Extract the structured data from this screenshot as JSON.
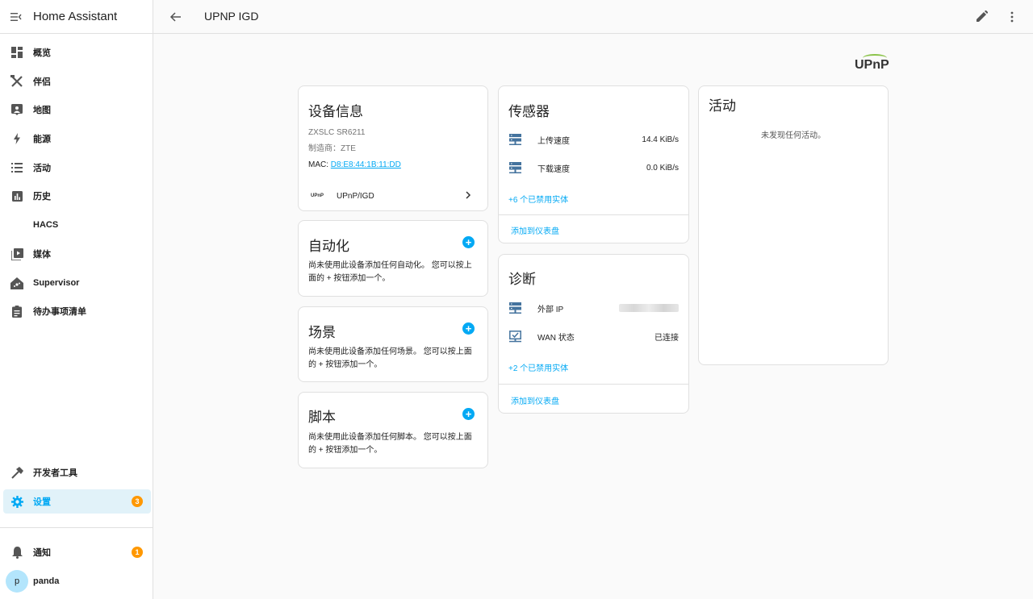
{
  "app": {
    "title": "Home Assistant"
  },
  "sidebar": {
    "items": [
      {
        "label": "概览",
        "icon": "dashboard-icon"
      },
      {
        "label": "伴侣",
        "icon": "tools-icon"
      },
      {
        "label": "地图",
        "icon": "map-icon"
      },
      {
        "label": "能源",
        "icon": "lightning-icon"
      },
      {
        "label": "活动",
        "icon": "list-icon"
      },
      {
        "label": "历史",
        "icon": "chart-icon"
      },
      {
        "label": "HACS",
        "icon": ""
      },
      {
        "label": "媒体",
        "icon": "media-icon"
      },
      {
        "label": "Supervisor",
        "icon": "home-assistant-icon"
      },
      {
        "label": "待办事项清单",
        "icon": "clipboard-icon"
      }
    ],
    "dev_tools": "开发者工具",
    "settings": "设置",
    "settings_badge": "3",
    "notifications": "通知",
    "notifications_badge": "1",
    "user_initial": "p",
    "user_name": "panda"
  },
  "topbar": {
    "title": "UPNP IGD"
  },
  "logo_text": "UPnP",
  "device_info": {
    "title": "设备信息",
    "model": "ZXSLC SR6211",
    "manufacturer": "制造商：ZTE",
    "mac_label": "MAC: ",
    "mac_value": "D8:E8:44:1B:11:DD",
    "integration_logo": "UPnP",
    "integration": "UPnP/IGD"
  },
  "automation": {
    "title": "自动化",
    "text": "尚未使用此设备添加任何自动化。 您可以按上面的 + 按钮添加一个。"
  },
  "scene": {
    "title": "场景",
    "text": "尚未使用此设备添加任何场景。 您可以按上面的 + 按钮添加一个。"
  },
  "script": {
    "title": "脚本",
    "text": "尚未使用此设备添加任何脚本。 您可以按上面的 + 按钮添加一个。"
  },
  "sensors": {
    "title": "传感器",
    "rows": [
      {
        "name": "上传速度",
        "value": "14.4 KiB/s"
      },
      {
        "name": "下载速度",
        "value": "0.0 KiB/s"
      }
    ],
    "disabled": "+6 个已禁用实体",
    "add_dashboard": "添加到仪表盘"
  },
  "diagnostics": {
    "title": "诊断",
    "rows": [
      {
        "name": "外部 IP",
        "value": ""
      },
      {
        "name": "WAN 状态",
        "value": "已连接"
      }
    ],
    "disabled": "+2 个已禁用实体",
    "add_dashboard": "添加到仪表盘"
  },
  "activity": {
    "title": "活动",
    "empty": "未发现任何活动。"
  },
  "colors": {
    "accent": "#03a9f4",
    "badge": "#ff9800",
    "active_bg": "#e1f2f9"
  }
}
